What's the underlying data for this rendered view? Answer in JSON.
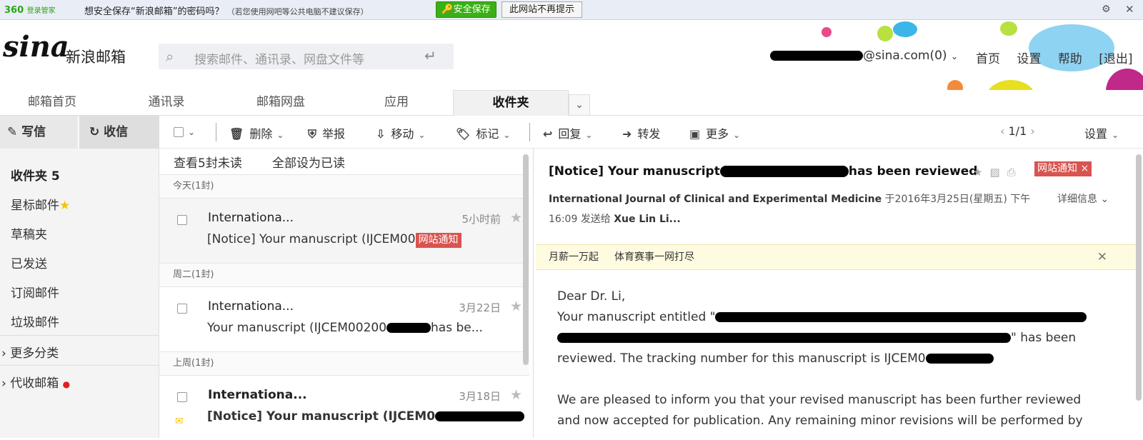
{
  "bar360": {
    "logo": "360",
    "logo_sub": "登录管家",
    "message": "想安全保存“新浪邮箱”的密码吗？",
    "hint": "（若您使用网吧等公共电脑不建议保存）",
    "save_label": "安全保存",
    "nomore_label": "此网站不再提示"
  },
  "header": {
    "logo": "sina",
    "logo_text": "新浪邮箱",
    "search_placeholder": "搜索邮件、通讯录、网盘文件等",
    "account_suffix": "@sina.com(0)",
    "links": [
      "首页",
      "设置",
      "帮助",
      "[退出]"
    ]
  },
  "tabs": [
    "邮箱首页",
    "通讯录",
    "邮箱网盘",
    "应用",
    "收件夹"
  ],
  "left": {
    "compose": "写信",
    "receive": "收信",
    "folders": [
      {
        "label": "收件夹 5"
      },
      {
        "label": "星标邮件"
      },
      {
        "label": "草稿夹"
      },
      {
        "label": "已发送"
      },
      {
        "label": "订阅邮件"
      },
      {
        "label": "垃圾邮件"
      },
      {
        "label": "更多分类"
      },
      {
        "label": "代收邮箱"
      }
    ]
  },
  "toolbar": {
    "delete": "删除",
    "report": "举报",
    "move": "移动",
    "mark": "标记",
    "reply": "回复",
    "forward": "转发",
    "more": "更多",
    "page": "1/1",
    "settings": "设置"
  },
  "list": {
    "view_unread": "查看5封未读",
    "mark_all_read": "全部设为已读",
    "groups": [
      "今天(1封)",
      "周二(1封)",
      "上周(1封)"
    ],
    "mails": [
      {
        "from": "Internationa...",
        "date": "5小时前",
        "subject": "[Notice] Your manuscript (IJCEM00",
        "badge": "网站通知"
      },
      {
        "from": "Internationa...",
        "date": "3月22日",
        "subject": "Your manuscript (IJCEM00200",
        "tail": "has be..."
      },
      {
        "from": "Internationa...",
        "date": "3月18日",
        "subject": "[Notice] Your manuscript (IJCEM0"
      }
    ]
  },
  "reader": {
    "subject_start": "[Notice] Your manuscript",
    "subject_end": "has been reviewed",
    "badge": "网站通知 ×",
    "sender": "International Journal of Clinical and Experimental Medicine",
    "date": "于2016年3月25日(星期五) 下午",
    "time": "16:09",
    "sent_to": "发送给",
    "recipient": "Xue Lin Li...",
    "detail": "详细信息",
    "ads": [
      "月薪一万起",
      "体育赛事一网打尽"
    ],
    "body": [
      "Dear Dr. Li,",
      "Your manuscript entitled \"",
      "\" has been",
      "reviewed. The tracking number for this manuscript is IJCEM0",
      "We are pleased to inform you that your revised manuscript has been further reviewed",
      "and now accepted for publication. Any remaining minor revisions will be performed by"
    ]
  }
}
